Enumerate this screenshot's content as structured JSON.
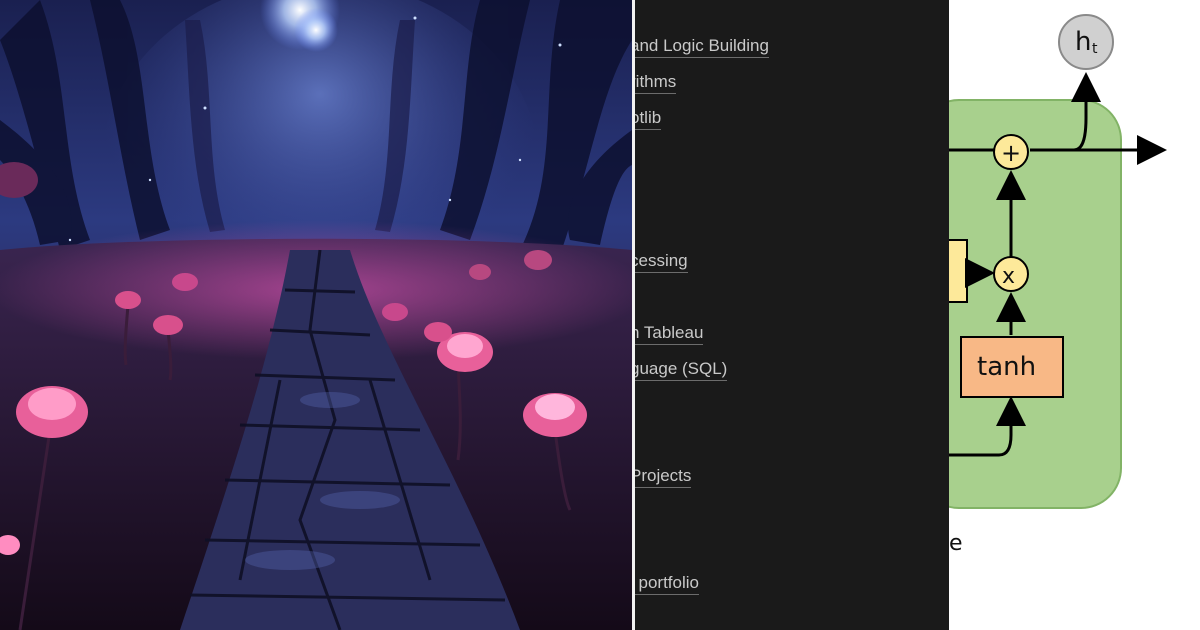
{
  "article_list": {
    "items": [
      {
        "label": "and Logic Building"
      },
      {
        "label": "rithms"
      },
      {
        "label": "otlib"
      },
      {
        "label": "cessing"
      },
      {
        "label": "n Tableau"
      },
      {
        "label": "guage (SQL)"
      },
      {
        "label": "Projects"
      },
      {
        "label": "l portfolio"
      }
    ]
  },
  "diagram": {
    "output_label": "h",
    "output_subscript": "t",
    "plus_symbol": "+",
    "multiply_symbol": "x",
    "tanh_label": "tanh",
    "caption_fragment": "e",
    "colors": {
      "cell_fill": "#a8d08d",
      "cell_stroke": "#82b366",
      "gate_fill": "#fde99a",
      "tanh_fill": "#f8b886",
      "output_node_fill": "#d0d0d0"
    }
  }
}
